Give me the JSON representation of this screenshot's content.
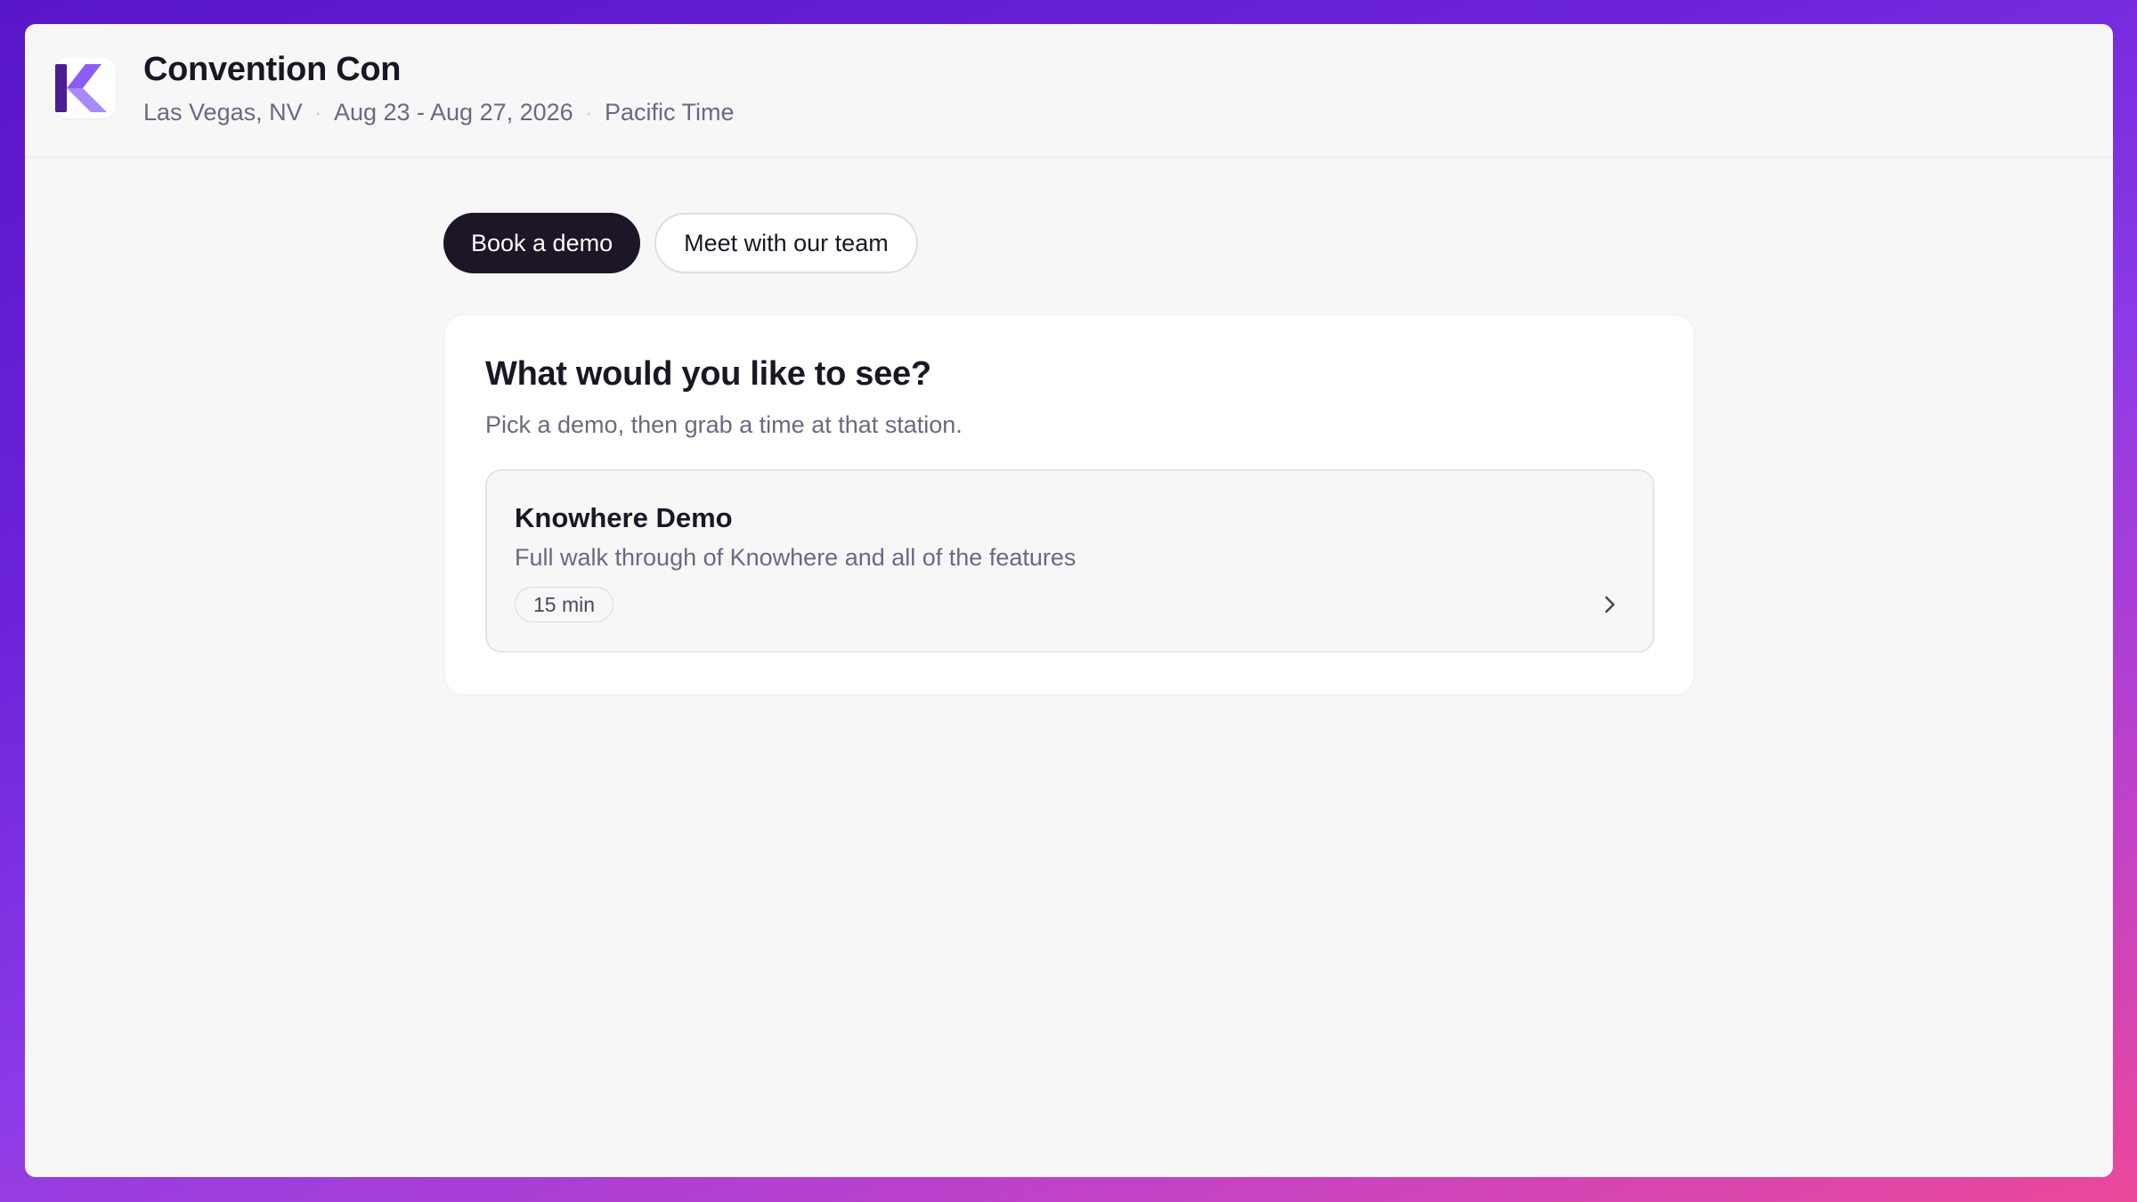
{
  "event": {
    "title": "Convention Con",
    "location": "Las Vegas, NV",
    "dates": "Aug 23 - Aug 27, 2026",
    "timezone": "Pacific Time"
  },
  "tabs": [
    {
      "label": "Book a demo",
      "active": true
    },
    {
      "label": "Meet with our team",
      "active": false
    }
  ],
  "card": {
    "title": "What would you like to see?",
    "subtitle": "Pick a demo, then grab a time at that station."
  },
  "demos": [
    {
      "name": "Knowhere Demo",
      "description": "Full walk through of Knowhere and all of the features",
      "duration": "15 min",
      "icon": "chevron-right-icon"
    }
  ],
  "colors": {
    "brand_dark": "#4c1d95",
    "brand_light": "#a78bfa",
    "active_tab": "#1c1626",
    "background_gradient_start": "#5a16c9",
    "background_gradient_end": "#ec4899"
  }
}
